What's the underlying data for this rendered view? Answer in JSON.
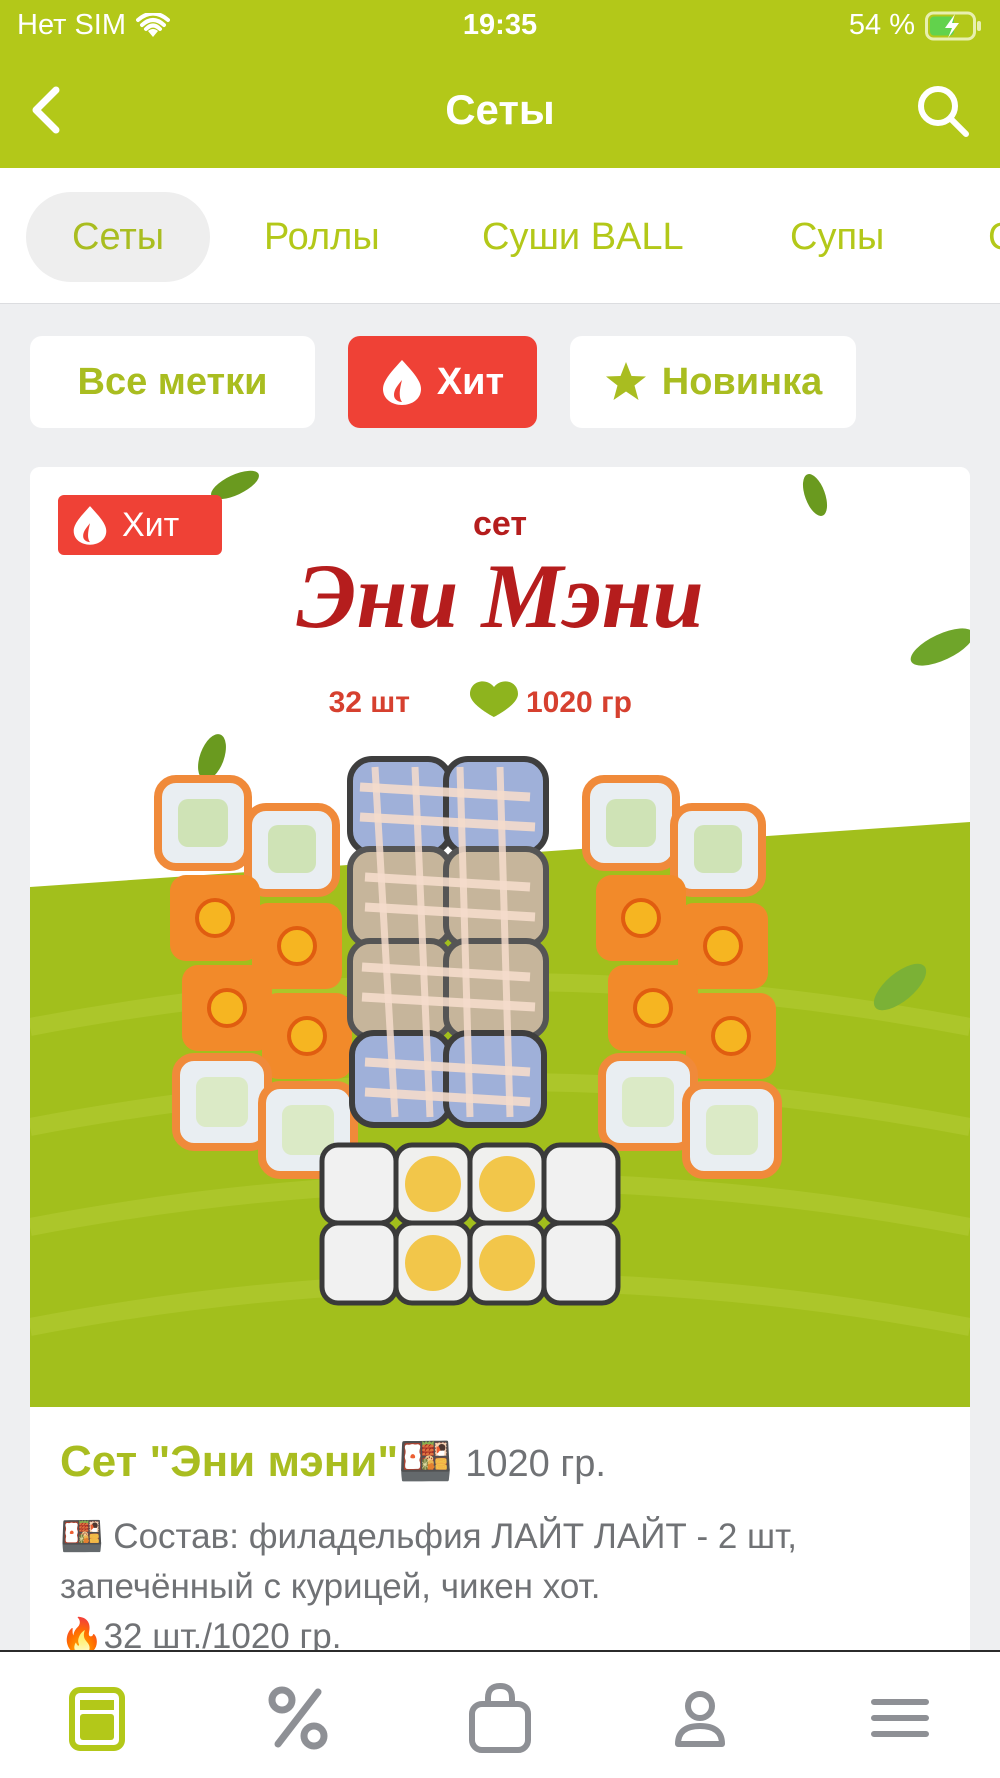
{
  "status": {
    "carrier": "Нет SIM",
    "time": "19:35",
    "battery": "54 %"
  },
  "nav": {
    "title": "Сеты"
  },
  "categories": [
    "Сеты",
    "Роллы",
    "Суши BALL",
    "Супы",
    "С"
  ],
  "filters": {
    "all": "Все метки",
    "hit": "Хит",
    "new": "Новинка"
  },
  "product": {
    "badge": "Хит",
    "image_text": {
      "set_word": "сет",
      "set_name": "Эни Мэни",
      "count": "32 шт",
      "weight": "1020 гр"
    },
    "name": "Сет \"Эни мэни\"🍱",
    "weight": "1020 гр.",
    "desc_line1": "🍱 Состав: филадельфия ЛАЙТ ЛАЙТ - 2 шт,",
    "desc_line2": "запечённый с курицей, чикен хот.",
    "desc_line3": "🔥32 шт./1020 гр."
  },
  "colors": {
    "brand": "#b3c819",
    "hit": "#ef4136",
    "text_gray": "#707275"
  },
  "icons": [
    "back-icon",
    "search-icon",
    "wifi-icon",
    "battery-icon",
    "flame-icon",
    "star-icon",
    "menu-tab-icon",
    "percent-tab-icon",
    "bag-tab-icon",
    "profile-tab-icon",
    "more-tab-icon"
  ]
}
